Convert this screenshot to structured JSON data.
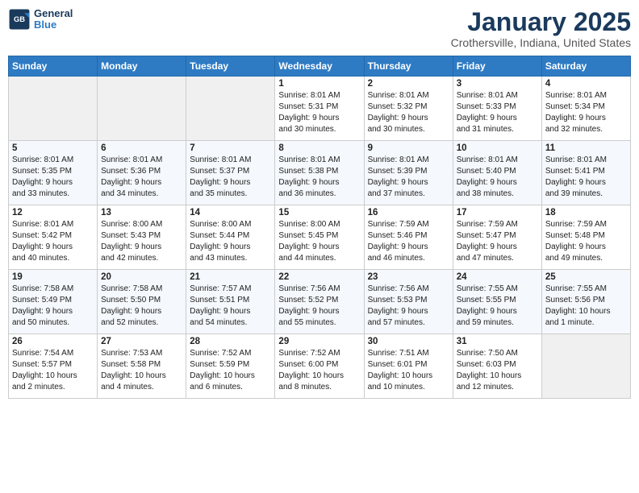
{
  "logo": {
    "line1": "General",
    "line2": "Blue"
  },
  "header": {
    "month": "January 2025",
    "location": "Crothersville, Indiana, United States"
  },
  "weekdays": [
    "Sunday",
    "Monday",
    "Tuesday",
    "Wednesday",
    "Thursday",
    "Friday",
    "Saturday"
  ],
  "weeks": [
    [
      {
        "day": "",
        "info": ""
      },
      {
        "day": "",
        "info": ""
      },
      {
        "day": "",
        "info": ""
      },
      {
        "day": "1",
        "info": "Sunrise: 8:01 AM\nSunset: 5:31 PM\nDaylight: 9 hours\nand 30 minutes."
      },
      {
        "day": "2",
        "info": "Sunrise: 8:01 AM\nSunset: 5:32 PM\nDaylight: 9 hours\nand 30 minutes."
      },
      {
        "day": "3",
        "info": "Sunrise: 8:01 AM\nSunset: 5:33 PM\nDaylight: 9 hours\nand 31 minutes."
      },
      {
        "day": "4",
        "info": "Sunrise: 8:01 AM\nSunset: 5:34 PM\nDaylight: 9 hours\nand 32 minutes."
      }
    ],
    [
      {
        "day": "5",
        "info": "Sunrise: 8:01 AM\nSunset: 5:35 PM\nDaylight: 9 hours\nand 33 minutes."
      },
      {
        "day": "6",
        "info": "Sunrise: 8:01 AM\nSunset: 5:36 PM\nDaylight: 9 hours\nand 34 minutes."
      },
      {
        "day": "7",
        "info": "Sunrise: 8:01 AM\nSunset: 5:37 PM\nDaylight: 9 hours\nand 35 minutes."
      },
      {
        "day": "8",
        "info": "Sunrise: 8:01 AM\nSunset: 5:38 PM\nDaylight: 9 hours\nand 36 minutes."
      },
      {
        "day": "9",
        "info": "Sunrise: 8:01 AM\nSunset: 5:39 PM\nDaylight: 9 hours\nand 37 minutes."
      },
      {
        "day": "10",
        "info": "Sunrise: 8:01 AM\nSunset: 5:40 PM\nDaylight: 9 hours\nand 38 minutes."
      },
      {
        "day": "11",
        "info": "Sunrise: 8:01 AM\nSunset: 5:41 PM\nDaylight: 9 hours\nand 39 minutes."
      }
    ],
    [
      {
        "day": "12",
        "info": "Sunrise: 8:01 AM\nSunset: 5:42 PM\nDaylight: 9 hours\nand 40 minutes."
      },
      {
        "day": "13",
        "info": "Sunrise: 8:00 AM\nSunset: 5:43 PM\nDaylight: 9 hours\nand 42 minutes."
      },
      {
        "day": "14",
        "info": "Sunrise: 8:00 AM\nSunset: 5:44 PM\nDaylight: 9 hours\nand 43 minutes."
      },
      {
        "day": "15",
        "info": "Sunrise: 8:00 AM\nSunset: 5:45 PM\nDaylight: 9 hours\nand 44 minutes."
      },
      {
        "day": "16",
        "info": "Sunrise: 7:59 AM\nSunset: 5:46 PM\nDaylight: 9 hours\nand 46 minutes."
      },
      {
        "day": "17",
        "info": "Sunrise: 7:59 AM\nSunset: 5:47 PM\nDaylight: 9 hours\nand 47 minutes."
      },
      {
        "day": "18",
        "info": "Sunrise: 7:59 AM\nSunset: 5:48 PM\nDaylight: 9 hours\nand 49 minutes."
      }
    ],
    [
      {
        "day": "19",
        "info": "Sunrise: 7:58 AM\nSunset: 5:49 PM\nDaylight: 9 hours\nand 50 minutes."
      },
      {
        "day": "20",
        "info": "Sunrise: 7:58 AM\nSunset: 5:50 PM\nDaylight: 9 hours\nand 52 minutes."
      },
      {
        "day": "21",
        "info": "Sunrise: 7:57 AM\nSunset: 5:51 PM\nDaylight: 9 hours\nand 54 minutes."
      },
      {
        "day": "22",
        "info": "Sunrise: 7:56 AM\nSunset: 5:52 PM\nDaylight: 9 hours\nand 55 minutes."
      },
      {
        "day": "23",
        "info": "Sunrise: 7:56 AM\nSunset: 5:53 PM\nDaylight: 9 hours\nand 57 minutes."
      },
      {
        "day": "24",
        "info": "Sunrise: 7:55 AM\nSunset: 5:55 PM\nDaylight: 9 hours\nand 59 minutes."
      },
      {
        "day": "25",
        "info": "Sunrise: 7:55 AM\nSunset: 5:56 PM\nDaylight: 10 hours\nand 1 minute."
      }
    ],
    [
      {
        "day": "26",
        "info": "Sunrise: 7:54 AM\nSunset: 5:57 PM\nDaylight: 10 hours\nand 2 minutes."
      },
      {
        "day": "27",
        "info": "Sunrise: 7:53 AM\nSunset: 5:58 PM\nDaylight: 10 hours\nand 4 minutes."
      },
      {
        "day": "28",
        "info": "Sunrise: 7:52 AM\nSunset: 5:59 PM\nDaylight: 10 hours\nand 6 minutes."
      },
      {
        "day": "29",
        "info": "Sunrise: 7:52 AM\nSunset: 6:00 PM\nDaylight: 10 hours\nand 8 minutes."
      },
      {
        "day": "30",
        "info": "Sunrise: 7:51 AM\nSunset: 6:01 PM\nDaylight: 10 hours\nand 10 minutes."
      },
      {
        "day": "31",
        "info": "Sunrise: 7:50 AM\nSunset: 6:03 PM\nDaylight: 10 hours\nand 12 minutes."
      },
      {
        "day": "",
        "info": ""
      }
    ]
  ]
}
